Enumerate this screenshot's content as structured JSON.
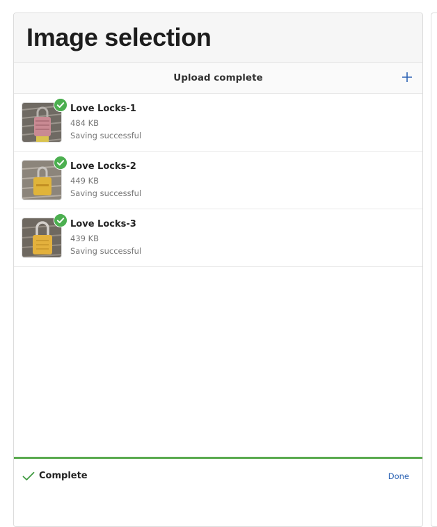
{
  "header": {
    "title": "Image selection"
  },
  "upload_bar": {
    "title": "Upload complete",
    "add_icon": "plus-icon"
  },
  "files": [
    {
      "name": "Love Locks-1",
      "size": "484 KB",
      "status": "Saving successful",
      "lock_color": "#c98a93"
    },
    {
      "name": "Love Locks-2",
      "size": "449 KB",
      "status": "Saving successful",
      "lock_color": "#e0b43a"
    },
    {
      "name": "Love Locks-3",
      "size": "439 KB",
      "status": "Saving successful",
      "lock_color": "#e3b13d"
    }
  ],
  "status": {
    "label": "Complete",
    "action": "Done"
  },
  "colors": {
    "accent": "#2c63b4",
    "success": "#4caf50",
    "progress": "#5aaa4e"
  }
}
